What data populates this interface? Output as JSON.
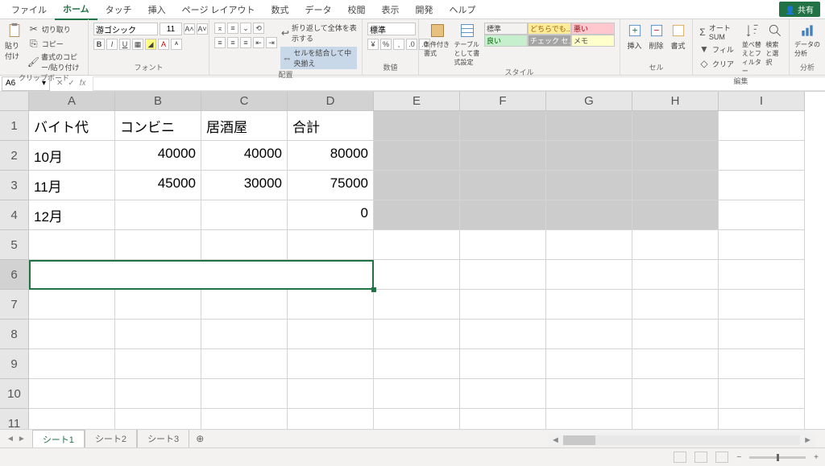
{
  "tabs": {
    "file": "ファイル",
    "home": "ホーム",
    "touch": "タッチ",
    "insert": "挿入",
    "page_layout": "ページ レイアウト",
    "formulas": "数式",
    "data": "データ",
    "review": "校閲",
    "view": "表示",
    "developer": "開発",
    "help": "ヘルプ"
  },
  "share": "共有",
  "clipboard": {
    "label": "クリップボード",
    "paste": "貼り付け",
    "cut": "切り取り",
    "copy": "コピー",
    "format_painter": "書式のコピー/貼り付け"
  },
  "font": {
    "label": "フォント",
    "name": "游ゴシック",
    "size": "11"
  },
  "alignment": {
    "label": "配置",
    "wrap": "折り返して全体を表示する",
    "merge": "セルを結合して中央揃え"
  },
  "number": {
    "label": "数値",
    "format": "標準"
  },
  "styles": {
    "label": "スタイル",
    "cond": "条件付き書式",
    "table": "テーブルとして書式設定",
    "cell_styles": "セルのスタイル",
    "s1": "標準",
    "s2": "どちらでも...",
    "s3": "悪い",
    "s4": "良い",
    "s5": "チェック セ...",
    "s6": "メモ"
  },
  "cells_grp": {
    "label": "セル",
    "insert": "挿入",
    "delete": "削除",
    "format": "書式"
  },
  "editing": {
    "label": "編集",
    "autosum": "オート SUM",
    "fill": "フィル",
    "clear": "クリア",
    "sort": "並べ替えとフィルター",
    "find": "検索と選択"
  },
  "analysis": {
    "label": "分析",
    "analyze": "データの分析"
  },
  "name_box": "A6",
  "columns": [
    "A",
    "B",
    "C",
    "D",
    "E",
    "F",
    "G",
    "H",
    "I"
  ],
  "rows": [
    "1",
    "2",
    "3",
    "4",
    "5",
    "6",
    "7",
    "8",
    "9",
    "10",
    "11"
  ],
  "sheet_data": {
    "A1": "バイト代",
    "B1": "コンビニ",
    "C1": "居酒屋",
    "D1": "合計",
    "A2": "10月",
    "B2": "40000",
    "C2": "40000",
    "D2": "80000",
    "A3": "11月",
    "B3": "45000",
    "C3": "30000",
    "D3": "75000",
    "A4": "12月",
    "D4": "0"
  },
  "sheets": {
    "s1": "シート1",
    "s2": "シート2",
    "s3": "シート3"
  },
  "zoom": "+"
}
